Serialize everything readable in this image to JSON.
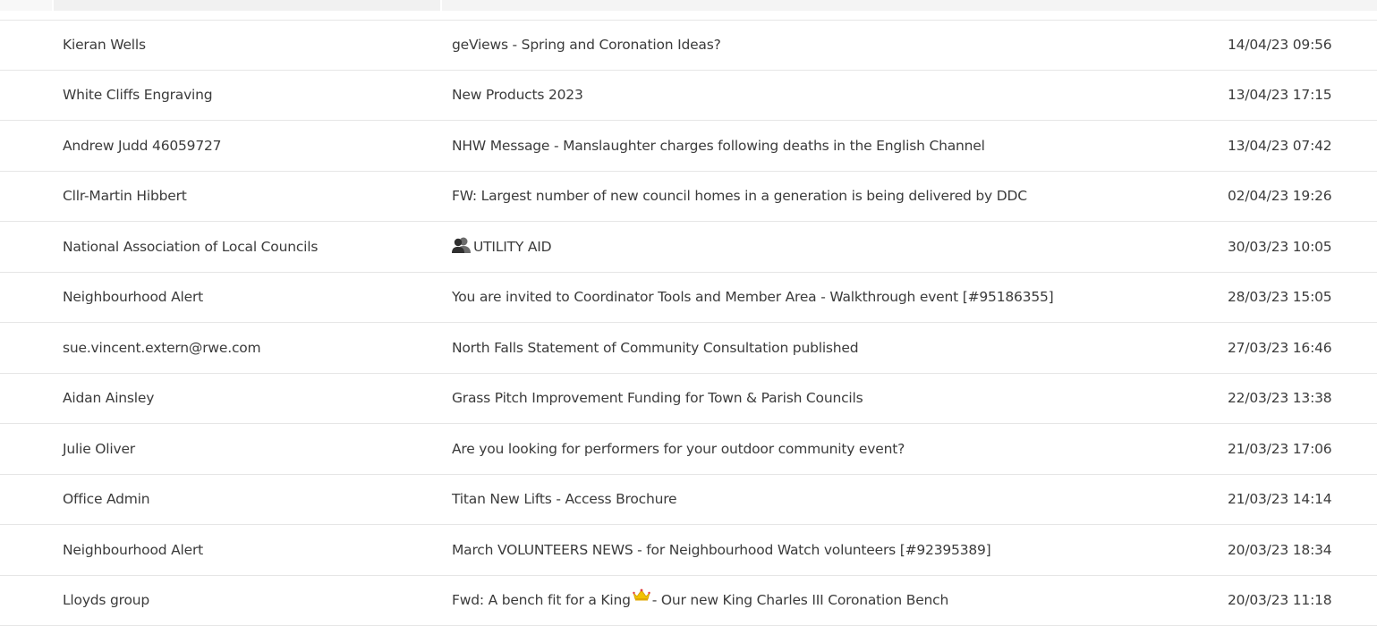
{
  "emails": [
    {
      "sender": "Kieran Wells",
      "subject": "geViews - Spring and Coronation Ideas?",
      "date": "14/04/23 09:56"
    },
    {
      "sender": "White Cliffs Engraving",
      "subject": "New Products 2023",
      "date": "13/04/23 17:15"
    },
    {
      "sender": "Andrew Judd 46059727",
      "subject": "NHW Message - Manslaughter charges following deaths in the English Channel",
      "date": "13/04/23 07:42"
    },
    {
      "sender": "Cllr-Martin Hibbert",
      "subject": "FW: Largest number of new council homes in a generation is being delivered by DDC",
      "date": "02/04/23 19:26"
    },
    {
      "sender": "National Association of Local Councils",
      "subject_icon": "people-icon",
      "subject": "UTILITY AID",
      "date": "30/03/23 10:05"
    },
    {
      "sender": "Neighbourhood Alert",
      "subject": "You are invited to Coordinator Tools and Member Area - Walkthrough event [#95186355]",
      "date": "28/03/23 15:05"
    },
    {
      "sender": "sue.vincent.extern@rwe.com",
      "subject": "North Falls Statement of Community Consultation published",
      "date": "27/03/23 16:46"
    },
    {
      "sender": "Aidan Ainsley",
      "subject": "Grass Pitch Improvement Funding for Town & Parish Councils",
      "date": "22/03/23 13:38"
    },
    {
      "sender": "Julie Oliver",
      "subject": "Are you looking for performers for your outdoor community event?",
      "date": "21/03/23 17:06"
    },
    {
      "sender": "Office Admin",
      "subject": "Titan New Lifts - Access Brochure",
      "date": "21/03/23 14:14"
    },
    {
      "sender": "Neighbourhood Alert",
      "subject": "March VOLUNTEERS NEWS - for Neighbourhood Watch volunteers [#92395389]",
      "date": "20/03/23 18:34"
    },
    {
      "sender": "Lloyds group",
      "subject_before": "Fwd: A bench fit for a King",
      "subject_icon": "crown-icon",
      "subject_after": "- Our new King Charles III Coronation Bench",
      "date": "20/03/23 11:18"
    }
  ]
}
